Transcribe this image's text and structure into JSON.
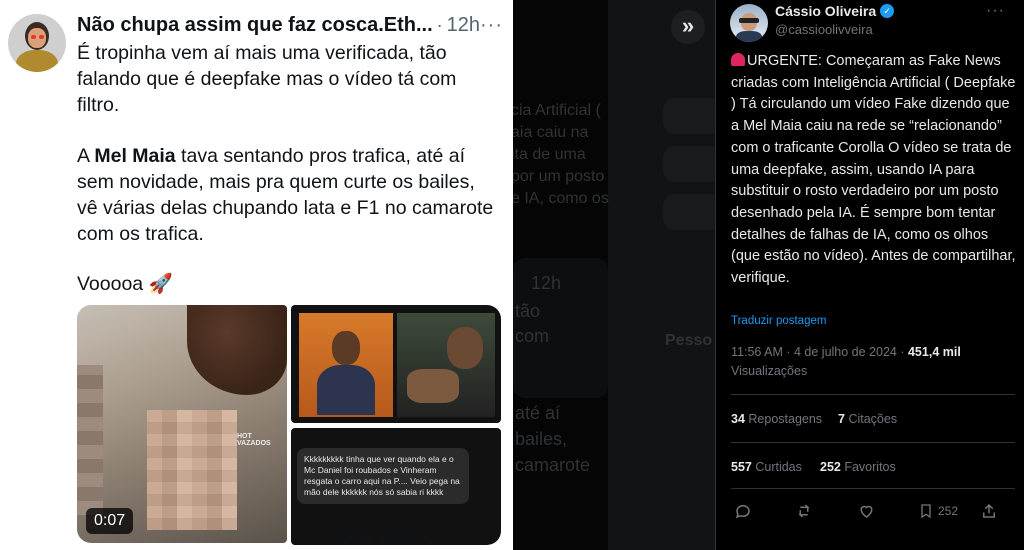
{
  "left_tweet": {
    "author": "Não chupa assim que faz cosca.Eth...",
    "time": "12h",
    "more": "···",
    "para1": "É tropinha vem aí mais uma verificada, tão falando que é deepfake mas o vídeo tá com filtro.",
    "para2_a": "A ",
    "para2_b": "Mel Maia",
    "para2_c": " tava sentando pros trafica, até aí sem novidade, mais pra quem curte os bailes, vê várias delas chupando lata e F1 no camarote com os trafica.",
    "para3": "Vooooa 🚀",
    "video_duration": "0:07",
    "watermark": "HOT VAZADOS",
    "chat_text": "Kkkkkkkkk tinha que ver quando ela e o Mc Daniel foi roubados e Vinheram resgata o carro aqui na P.... Veio pega na mão dele kkkkkk nós só sabia ri kkkk",
    "chat_emojis": "😂😂😂😂😂"
  },
  "middle": {
    "expand_icon": "»",
    "ghost_lines": [
      "cia Artificial (",
      "aia caiu na",
      "ita de uma",
      "por um posto",
      "e IA, como os"
    ],
    "ghost_lines2": [
      "12h",
      "tão",
      "com",
      "até aí",
      "bailes,",
      "camarote"
    ],
    "ghost_left": [
      "Pesso"
    ]
  },
  "right_tweet": {
    "name": "Cássio Oliveira",
    "handle": "@cassioolivveira",
    "more": "···",
    "body": "URGENTE: Começaram as Fake News criadas com Inteligência Artificial ( Deepfake ) Tá circulando um vídeo Fake dizendo que a Mel Maia caiu na rede se “relacionando” com o traficante Corolla O vídeo se trata de uma deepfake, assim, usando IA para substituir o rosto verdadeiro por um posto desenhado pela IA. É sempre bom tentar detalhes de falhas de IA, como os olhos (que estão no vídeo). Antes de compartilhar, verifique.",
    "translate": "Traduzir postagem",
    "timestamp": "11:56 AM · 4 de julho de 2024 · ",
    "views_count": "451,4 mil",
    "views_label": "Visualizações",
    "reposts_count": "34",
    "reposts_label": "Repostagens",
    "quotes_count": "7",
    "quotes_label": "Citações",
    "comments_count": "557",
    "comments_label": "Curtidas",
    "likes_count": "252",
    "likes_label": "Favoritos",
    "bookmark_count": "252"
  },
  "colors": {
    "accent": "#1d9bf0",
    "dark_bg": "#000000",
    "muted": "#71767b"
  }
}
